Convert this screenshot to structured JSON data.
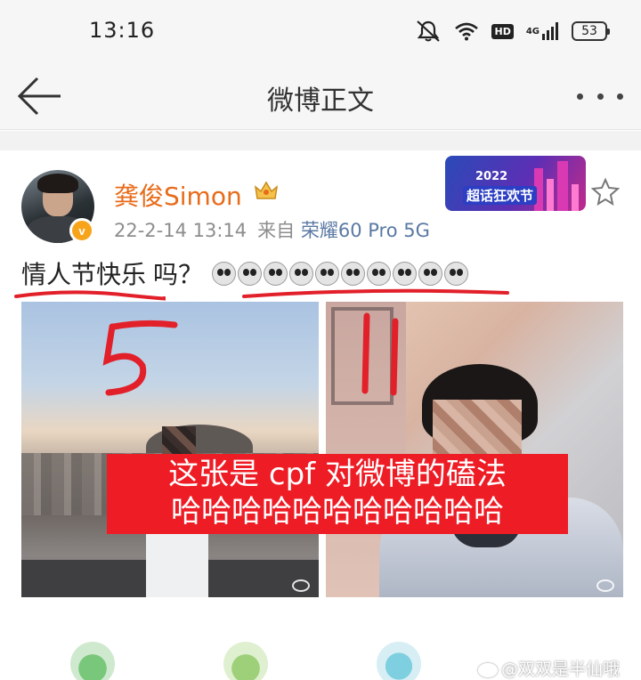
{
  "status_bar": {
    "time": "13:16",
    "network_label": "4G",
    "hd_label": "HD",
    "battery_level": "53",
    "icons": [
      "mute-icon",
      "wifi-icon",
      "hd-icon",
      "signal-4g-icon",
      "battery-icon"
    ]
  },
  "navbar": {
    "title": "微博正文",
    "back_icon": "arrow-left-icon",
    "more_icon": "more-dots-icon"
  },
  "post": {
    "user_name": "龚俊Simon",
    "verified_badge": "v",
    "crown_icon": "crown-icon",
    "timestamp": "22-2-14 13:14",
    "source_prefix": "来自",
    "device": "荣耀60 Pro 5G",
    "event_banner": {
      "year": "2022",
      "name": "超话狂欢节"
    },
    "favorite_icon": "star-icon",
    "text_main": "情人节快乐",
    "text_question": "吗？",
    "emoji_count": 10,
    "emoji_icon": "panda-emoji-icon",
    "overlay_numbers": [
      "5",
      "1"
    ],
    "caption_lines": [
      "这张是 cpf 对微博的磕法",
      "哈哈哈哈哈哈哈哈哈哈哈"
    ],
    "watermark": "@双双是半仙哦"
  },
  "colors": {
    "username": "#e86b1a",
    "device_link": "#5a79a3",
    "caption_bg": "#ee1c25",
    "annotation_red": "#e2202a",
    "verified": "#f7a41b"
  }
}
